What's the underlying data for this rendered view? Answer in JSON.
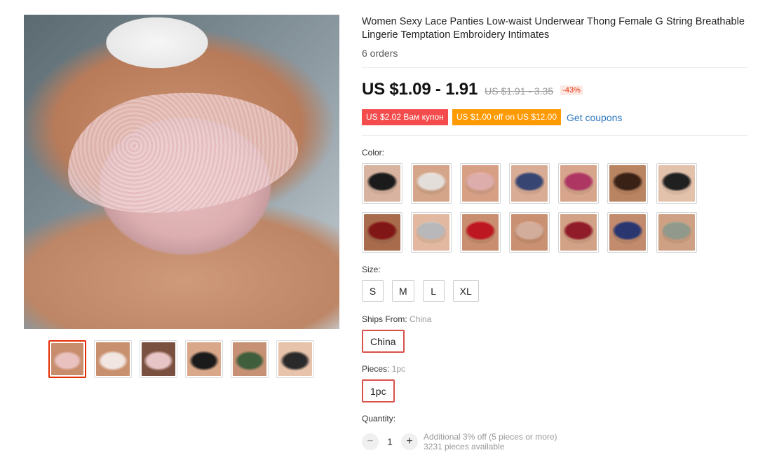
{
  "product": {
    "title": "Women Sexy Lace Panties Low-waist Underwear Thong Female G String Breathable Lingerie Temptation Embroidery Intimates",
    "orders": "6 orders",
    "price": "US $1.09 - 1.91",
    "original_price": "US $1.91 - 3.35",
    "discount": "-43%",
    "coupons": [
      {
        "text": "US $2.02 Вам купон",
        "color": "#f44c4c"
      },
      {
        "text": "US $1.00 off on US $12.00",
        "color": "#ff9a03"
      }
    ],
    "get_coupons": "Get coupons"
  },
  "gallery": {
    "thumbnails": [
      {
        "name": "pink-lace",
        "colors": [
          "#e9c2c0",
          "#c78d6d"
        ]
      },
      {
        "name": "white-lace-back",
        "colors": [
          "#f1e6e2",
          "#c9906f"
        ]
      },
      {
        "name": "pink-side",
        "colors": [
          "#e7c4c5",
          "#7a5040"
        ]
      },
      {
        "name": "black-lace",
        "colors": [
          "#1a1a1a",
          "#d9a789"
        ]
      },
      {
        "name": "green",
        "colors": [
          "#3f5e3c",
          "#c69174"
        ]
      },
      {
        "name": "black",
        "colors": [
          "#2a2a2a",
          "#e6c3aa"
        ]
      }
    ]
  },
  "color": {
    "label": "Color:",
    "options": [
      {
        "name": "black",
        "colors": [
          "#1d1d1d",
          "#d8b4a0"
        ]
      },
      {
        "name": "white",
        "colors": [
          "#f3ece8",
          "#d4a588"
        ]
      },
      {
        "name": "pink",
        "colors": [
          "#eab8b6",
          "#d7a085"
        ]
      },
      {
        "name": "navy",
        "colors": [
          "#3a4a7a",
          "#d9ad95"
        ]
      },
      {
        "name": "rose",
        "colors": [
          "#b83a6a",
          "#d6a58c"
        ]
      },
      {
        "name": "brown",
        "colors": [
          "#3e2418",
          "#b98461"
        ]
      },
      {
        "name": "black-lace",
        "colors": [
          "#222",
          "#e3c2ab"
        ]
      },
      {
        "name": "red-black",
        "colors": [
          "#8a1818",
          "#a86c4d"
        ]
      },
      {
        "name": "grey",
        "colors": [
          "#c4c4c6",
          "#e2b9a0"
        ]
      },
      {
        "name": "red",
        "colors": [
          "#c91a24",
          "#c98e6f"
        ]
      },
      {
        "name": "nude",
        "colors": [
          "#e0b8a6",
          "#c99071"
        ]
      },
      {
        "name": "wine",
        "colors": [
          "#9a1d2c",
          "#d2a286"
        ]
      },
      {
        "name": "blue",
        "colors": [
          "#2c3a78",
          "#c28b6d"
        ]
      },
      {
        "name": "sage",
        "colors": [
          "#9aa394",
          "#cfa184"
        ]
      }
    ]
  },
  "size": {
    "label": "Size:",
    "options": [
      "S",
      "M",
      "L",
      "XL"
    ]
  },
  "ships_from": {
    "label": "Ships From:",
    "selected": "China",
    "value": "China"
  },
  "pieces": {
    "label": "Pieces:",
    "selected": "1pc",
    "value": "1pc"
  },
  "quantity": {
    "label": "Quantity:",
    "value": "1",
    "minus": "−",
    "plus": "+",
    "offer": "Additional 3% off (5 pieces or more)",
    "available": "3231 pieces available"
  },
  "colors": {
    "accent_red": "#e62e04",
    "link_blue": "#2e77c0",
    "selected_border": "#d9514b"
  }
}
